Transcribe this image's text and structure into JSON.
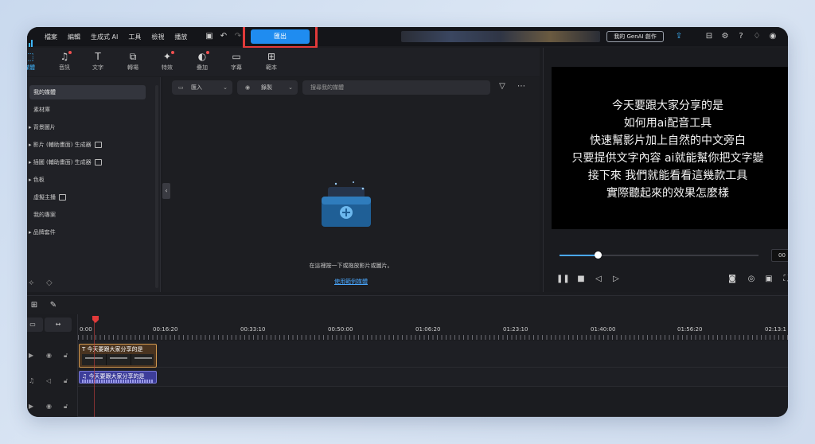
{
  "menu": [
    "檔案",
    "編輯",
    "生成式 AI",
    "工具",
    "檢視",
    "播放"
  ],
  "export_label": "匯出",
  "genai_label": "我的 GenAI 創作",
  "toolbar": [
    {
      "label": "媒體",
      "icon": "media-icon",
      "glyph": "⬚"
    },
    {
      "label": "音訊",
      "icon": "music-icon",
      "glyph": "♫"
    },
    {
      "label": "文字",
      "icon": "text-icon",
      "glyph": "T"
    },
    {
      "label": "轉場",
      "icon": "transition-icon",
      "glyph": "⧉"
    },
    {
      "label": "特效",
      "icon": "effects-icon",
      "glyph": "✦"
    },
    {
      "label": "疊加",
      "icon": "overlay-icon",
      "glyph": "◐"
    },
    {
      "label": "字幕",
      "icon": "subtitle-icon",
      "glyph": "▭"
    },
    {
      "label": "範本",
      "icon": "template-icon",
      "glyph": "⊞"
    }
  ],
  "left_panel": {
    "items": [
      {
        "label": "我的媒體"
      },
      {
        "label": "素材庫"
      },
      {
        "label": "▸ 背景圖片"
      },
      {
        "label": "▸ 影片 (輔助畫面) 生成器"
      },
      {
        "label": "▸ 插圖 (輔助畫面) 生成器"
      },
      {
        "label": "▸ 色板"
      },
      {
        "label": "虛擬主播"
      },
      {
        "label": "我的專案"
      },
      {
        "label": "▸ 品牌套件"
      }
    ]
  },
  "media": {
    "import_label": "匯入",
    "record_label": "錄製",
    "search_placeholder": "搜尋我的媒體",
    "empty_text": "在這裡按一下或拖放影片或圖片。",
    "sample_link": "使用範例媒體"
  },
  "preview": {
    "subtitle_lines": [
      "今天要跟大家分享的是",
      "如何用ai配音工具",
      "快速幫影片加上自然的中文旁白",
      "只要提供文字內容 ai就能幫你把文字變",
      "接下來 我們就能看看這幾款工具",
      "實際聽起來的效果怎麼樣"
    ],
    "progress": 0.19,
    "timecode": "00"
  },
  "timeline": {
    "ticks": [
      "0:00",
      "00:16:20",
      "00:33:10",
      "00:50:00",
      "01:06:20",
      "01:23:10",
      "01:40:00",
      "01:56:20",
      "02:13:1"
    ],
    "title_clip": "今天要跟大家分享的是",
    "audio_clip": "今天要跟大家分享的是"
  },
  "colors": {
    "accent": "#1f8cf0",
    "highlight": "#e23a3a",
    "title_clip": "#d39a50",
    "audio_clip": "#3d3d9a"
  }
}
